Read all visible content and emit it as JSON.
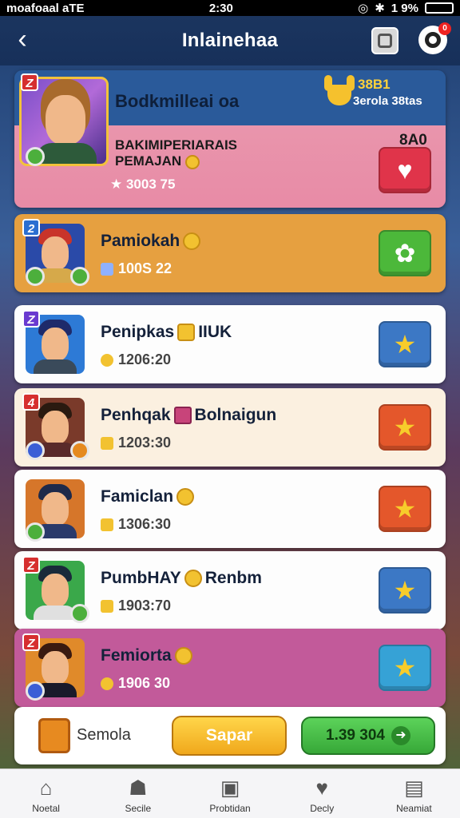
{
  "status": {
    "left": "moafoaal aTE",
    "time": "2:30",
    "battery": "1 9%"
  },
  "header": {
    "title": "Inlainehaa",
    "badge": "0"
  },
  "featured": {
    "rank": "Z",
    "name": "Bodkmilleai oa",
    "trophy_value": "38B1",
    "trophy_sub": "3erola 38tas",
    "subtitle": "BAKIMIPERIARAIS PEMAJAN",
    "score": "3003 75",
    "top_value": "8A0",
    "action_icon": "heart-icon"
  },
  "rows": [
    {
      "rank": "2",
      "name": "Pamiokah",
      "score": "100S 22",
      "action_icon": "cow-icon"
    },
    {
      "rank": "Z",
      "name": "Penipkas",
      "name_extra": "IIUK",
      "score": "1206:20",
      "action_icon": "star-icon"
    },
    {
      "rank": "4",
      "name": "Penhqak",
      "name_extra": "Bolnaigun",
      "score": "1203:30",
      "action_icon": "star-icon"
    },
    {
      "rank": "",
      "name": "Famiclan",
      "score": "1306:30",
      "action_icon": "star-icon"
    },
    {
      "rank": "Z",
      "name": "PumbHAY",
      "name_extra": "Renbm",
      "score": "1903:70",
      "action_icon": "star-icon"
    },
    {
      "rank": "Z",
      "name": "Femiorta",
      "score": "1906 30",
      "action_icon": "star-icon"
    }
  ],
  "bottom": {
    "chest_label": "Semola",
    "yellow_button": "Sapar",
    "green_button": "1.39 304"
  },
  "nav": [
    {
      "label": "Noetal",
      "icon": "home-icon"
    },
    {
      "label": "Secile",
      "icon": "user-icon"
    },
    {
      "label": "Probtidan",
      "icon": "shield-icon"
    },
    {
      "label": "Decly",
      "icon": "heart-icon"
    },
    {
      "label": "Neamiat",
      "icon": "clipboard-icon"
    }
  ]
}
